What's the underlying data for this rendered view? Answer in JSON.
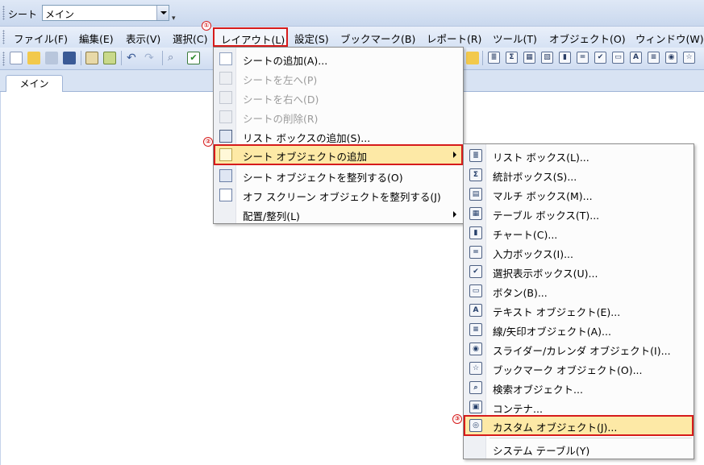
{
  "sheetbar": {
    "label": "シート",
    "selected": "メイン"
  },
  "menubar": {
    "items": [
      "ファイル(F)",
      "編集(E)",
      "表示(V)",
      "選択(C)",
      "レイアウト(L)",
      "設定(S)",
      "ブックマーク(B)",
      "レポート(R)",
      "ツール(T)",
      "オブジェクト(O)",
      "ウィンドウ(W)"
    ]
  },
  "tabs": {
    "active": "メイン"
  },
  "badges": [
    "①",
    "②",
    "③"
  ],
  "layout_menu": {
    "items": [
      {
        "label": "シートの追加(A)...",
        "icon": "sheet-add-icon",
        "disabled": false
      },
      {
        "label": "シートを左へ(P)",
        "icon": "sheet-left-icon",
        "disabled": true
      },
      {
        "label": "シートを右へ(D)",
        "icon": "sheet-right-icon",
        "disabled": true
      },
      {
        "label": "シートの削除(R)",
        "icon": "sheet-delete-icon",
        "disabled": true
      },
      {
        "label": "リスト ボックスの追加(S)...",
        "icon": "listbox-add-icon",
        "disabled": false
      },
      {
        "label": "シート オブジェクトの追加",
        "icon": "object-add-icon",
        "disabled": false
      },
      {
        "label": "シート オブジェクトを整列する(O)",
        "icon": "arrange-icon",
        "disabled": false
      },
      {
        "label": "オフ スクリーン オブジェクトを整列する(J)",
        "icon": "offscreen-arrange-icon",
        "disabled": false
      },
      {
        "label": "配置/整列(L)",
        "icon": "",
        "disabled": false
      }
    ]
  },
  "object_submenu": {
    "items": [
      {
        "label": "リスト ボックス(L)...",
        "glyph": "≣"
      },
      {
        "label": "統計ボックス(S)...",
        "glyph": "Σ"
      },
      {
        "label": "マルチ ボックス(M)...",
        "glyph": "▤"
      },
      {
        "label": "テーブル ボックス(T)...",
        "glyph": "▦"
      },
      {
        "label": "チャート(C)...",
        "glyph": "▮"
      },
      {
        "label": "入力ボックス(I)...",
        "glyph": "="
      },
      {
        "label": "選択表示ボックス(U)...",
        "glyph": "✔"
      },
      {
        "label": "ボタン(B)...",
        "glyph": "▭"
      },
      {
        "label": "テキスト オブジェクト(E)...",
        "glyph": "A"
      },
      {
        "label": "線/矢印オブジェクト(A)...",
        "glyph": "≡"
      },
      {
        "label": "スライダー/カレンダ オブジェクト(I)...",
        "glyph": "◉"
      },
      {
        "label": "ブックマーク オブジェクト(O)...",
        "glyph": "☆"
      },
      {
        "label": "検索オブジェクト...",
        "glyph": "⌕"
      },
      {
        "label": "コンテナ...",
        "glyph": "▣"
      },
      {
        "label": "カスタム オブジェクト(J)...",
        "glyph": "◎"
      },
      {
        "label": "システム テーブル(Y)",
        "glyph": ""
      }
    ]
  },
  "toolbar": {
    "left_icons": [
      "new-icon",
      "open-icon",
      "reload-icon",
      "save-icon",
      "edit-icon",
      "export-icon",
      "undo-icon",
      "redo-icon",
      "search-icon",
      "check-icon"
    ],
    "right_glyphs": [
      "▤",
      "≣",
      "Σ",
      "▦",
      "▧",
      "▮",
      "=",
      "✔",
      "▭",
      "A",
      "≡",
      "◉",
      "☆",
      "⌕"
    ]
  },
  "colors": {
    "highlight": "#fde9a6",
    "callout": "#d61b1b",
    "chrome": "#d6e2f4"
  }
}
